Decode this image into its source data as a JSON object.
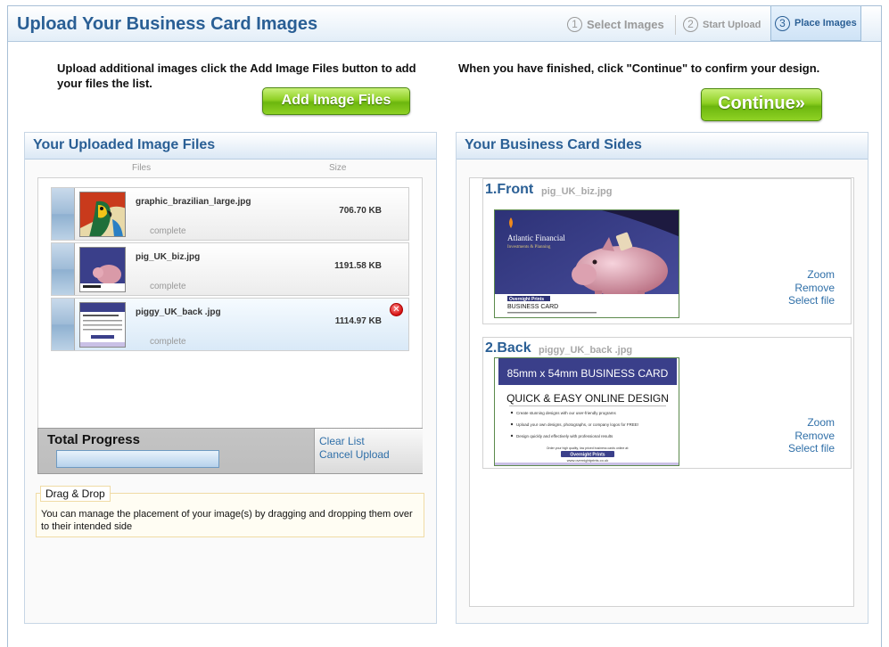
{
  "header": {
    "title": "Upload Your Business Card Images",
    "steps": [
      {
        "num": "1",
        "label": "Select Images"
      },
      {
        "num": "2",
        "label": "Start Upload"
      },
      {
        "num": "3",
        "label": "Place Images"
      }
    ]
  },
  "instructions": {
    "left": "Upload additional images click the Add Image Files button to add your files the list.",
    "right": "When you have finished, click \"Continue\" to confirm your design."
  },
  "buttons": {
    "add_files": "Add Image Files",
    "continue": "Continue»"
  },
  "uploaded_panel": {
    "title": "Your Uploaded Image Files",
    "col_files": "Files",
    "col_size": "Size",
    "files": [
      {
        "name": "graphic_brazilian_large.jpg",
        "size": "706.70 KB",
        "status": "complete"
      },
      {
        "name": "pig_UK_biz.jpg",
        "size": "1191.58 KB",
        "status": "complete"
      },
      {
        "name": "piggy_UK_back .jpg",
        "size": "1114.97 KB",
        "status": "complete"
      }
    ],
    "progress_title": "Total Progress",
    "progress_fraction": 0,
    "clear_list": "Clear List",
    "cancel_upload": "Cancel Upload",
    "dd_label": "Drag & Drop",
    "dd_text": "You can manage the placement of your image(s) by dragging and dropping them over to their intended side"
  },
  "sides_panel": {
    "title": "Your Business Card Sides",
    "sides": [
      {
        "label": "1.Front",
        "file": "pig_UK_biz.jpg",
        "zoom": "Zoom",
        "remove": "Remove",
        "select": "Select file"
      },
      {
        "label": "2.Back",
        "file": "piggy_UK_back .jpg",
        "zoom": "Zoom",
        "remove": "Remove",
        "select": "Select file"
      }
    ]
  },
  "front_card": {
    "company": "Atlantic Financial",
    "tagline": "Investments & Planning",
    "brand": "Overnight Prints",
    "card_label": "BUSINESS CARD"
  },
  "back_card": {
    "heading": "85mm x 54mm BUSINESS CARD",
    "subheading": "QUICK & EASY ONLINE DESIGN",
    "bullets": [
      "Create stunning designs with our user-friendly programs",
      "Upload your own designs, photographs, or company logos for FREE!",
      "Design quickly and effectively with professional results"
    ],
    "footer": "Order your high quality, low priced business cards online at:",
    "brand": "Overnight Prints",
    "url": "www.overnightprints.co.uk"
  },
  "colors": {
    "brand_blue": "#2a5f95",
    "link_blue": "#2f6fa8",
    "button_green": "#8fd024",
    "card_purple": "#3a3f8a"
  }
}
